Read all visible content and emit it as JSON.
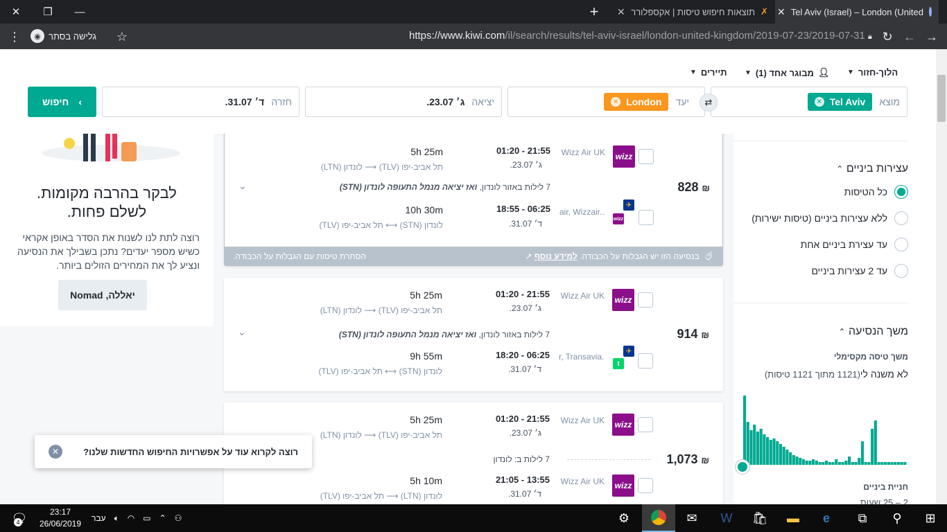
{
  "browser": {
    "tabs": [
      {
        "title": "Tel Aviv (Israel) – London (United"
      },
      {
        "title": "תוצאות חיפוש טיסות | אקספלורר"
      }
    ],
    "url_main": "https://www.kiwi.com",
    "url_path": "/il/search/results/tel-aviv-israel/london-united-kingdom/2019-07-23/2019-07-31",
    "incognito_label": "גלישה בסתר"
  },
  "search": {
    "trip_type": "הלוך-חזור",
    "passengers": "מבוגר אחד (1)",
    "bags": "תיירים",
    "from_label": "מוצא",
    "from_value": "Tel Aviv",
    "to_label": "יעד",
    "to_value": "London",
    "depart_label": "יציאה",
    "depart_value": "ג׳ 23.07.",
    "return_label": "חזרה",
    "return_value": "ד׳ 31.07.",
    "search_button": "חיפוש"
  },
  "promo": {
    "title_1": "לבקר בהרבה מקומות.",
    "title_2": "לשלם פחות.",
    "text": "רוצה לתת לנו לשנות את הסדר באופן אקראי כשיש מספר יעדים? נתכן בשבילך את הנסיעה ונציע לך את המחירים הזולים ביותר.",
    "button": "יאללה, Nomad"
  },
  "results": [
    {
      "price": "828",
      "currency": "₪",
      "out": {
        "airline": "Wizz Air UK",
        "times": "01:20 - 21:55",
        "date": "ג׳ 23.07.",
        "duration": "5h 25m",
        "route": "תל אביב-יפו (TLV) ⟶ לונדון (LTN)"
      },
      "nights_plain": "7 לילות באזור לונדון,",
      "nights_bold": "ואז יציאה מנמל התעופה לונדון (STN)",
      "back": {
        "airline": "air, Wizzair...",
        "times": "18:55 - 06:25",
        "date": "ד׳ 31.07.",
        "duration": "10h 30m",
        "route": "לונדון (STN) ⟷ תל אביב-יפו (TLV)"
      },
      "footer_info": "בנסיעה הזו יש הגבלות על הכבודה.",
      "footer_link": "למידע נוסף",
      "footer_left": "הסתרת טיסות עם הגבלות על הכבודה."
    },
    {
      "price": "914",
      "currency": "₪",
      "out": {
        "airline": "Wizz Air UK",
        "times": "01:20 - 21:55",
        "date": "ג׳ 23.07.",
        "duration": "5h 25m",
        "route": "תל אביב-יפו (TLV) ⟶ לונדון (LTN)"
      },
      "nights_plain": "7 לילות באזור לונדון,",
      "nights_bold": "ואז יציאה מנמל התעופה לונדון (STN)",
      "back": {
        "airline": "r, Transavia...",
        "times": "18:20 - 06:25",
        "date": "ד׳ 31.07.",
        "duration": "9h 55m",
        "route": "לונדון (STN) ⟷ תל אביב-יפו (TLV)"
      }
    },
    {
      "price": "1,073",
      "currency": "₪",
      "out": {
        "airline": "Wizz Air UK",
        "times": "01:20 - 21:55",
        "date": "ג׳ 23.07.",
        "duration": "5h 25m",
        "route": "תל אביב-יפו (TLV) ⟶ לונדון (LTN)"
      },
      "nights_plain": "7 לילות ב: לונדון",
      "back": {
        "airline": "Wizz Air UK",
        "times": "21:05 - 13:55",
        "date": "ד׳ 31.07.",
        "duration": "5h 10m",
        "route": "לונדון (LTN) ⟶ תל אביב-יפו (TLV)"
      }
    }
  ],
  "filters": {
    "stops_title": "עצירות ביניים",
    "stops": [
      {
        "label": "כל הטיסות",
        "selected": true
      },
      {
        "label": "ללא עצירות ביניים (טיסות ישירות)",
        "selected": false
      },
      {
        "label": "עד עצירת ביניים אחת",
        "selected": false
      },
      {
        "label": "עד 2 עצירות ביניים",
        "selected": false
      }
    ],
    "duration_title": "משך הנסיעה",
    "max_duration_label": "משך טיסה מקסימלי",
    "max_duration_value": "לא משנה לי",
    "max_duration_count": "(1121 מתוך 1121 טיסות)",
    "histogram": [
      100,
      62,
      50,
      58,
      48,
      52,
      44,
      40,
      36,
      38,
      34,
      30,
      26,
      22,
      18,
      14,
      12,
      10,
      8,
      6,
      6,
      8,
      6,
      4,
      4,
      6,
      4,
      4,
      8,
      4,
      4,
      6,
      12,
      4,
      4,
      10,
      34,
      4,
      4,
      52,
      64,
      4,
      4,
      4,
      4,
      4,
      4,
      4,
      4,
      4
    ],
    "layover_label": "חניית ביניים",
    "layover_value": "2 – 25 שעות"
  },
  "toast": {
    "text": "רוצה לקרוא עוד על אפשרויות החיפוש החדשות שלנו?"
  },
  "taskbar": {
    "time": "23:17",
    "date": "26/06/2019",
    "lang": "עבר",
    "notif_count": "4"
  }
}
